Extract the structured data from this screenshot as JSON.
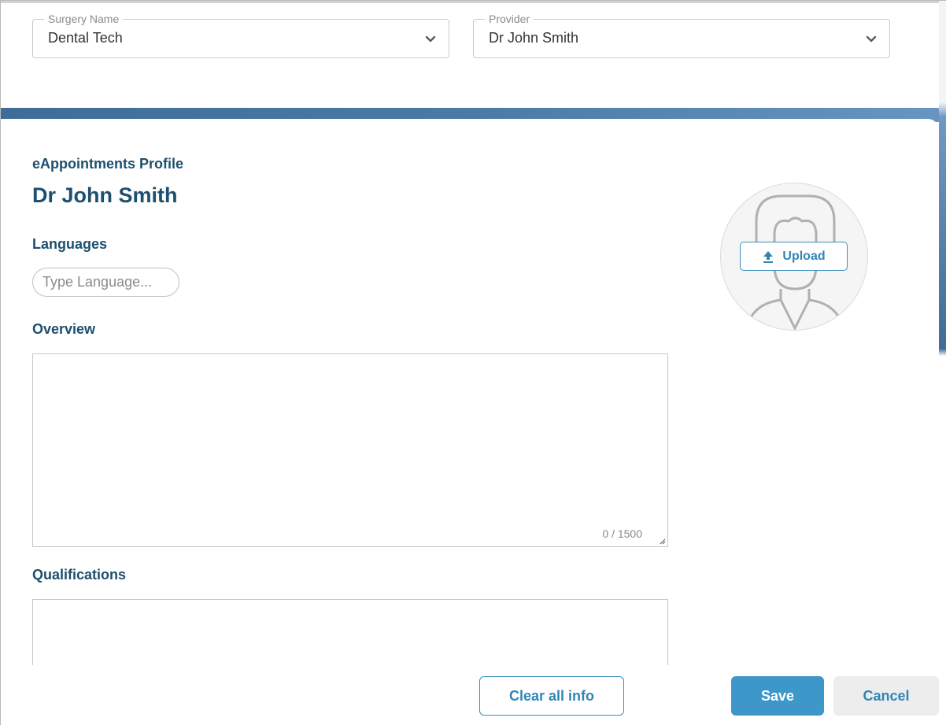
{
  "filters": {
    "surgery": {
      "label": "Surgery Name",
      "value": "Dental Tech"
    },
    "provider": {
      "label": "Provider",
      "value": "Dr John Smith"
    }
  },
  "profile": {
    "section_title": "eAppointments Profile",
    "name": "Dr John Smith",
    "languages_label": "Languages",
    "language_placeholder": "Type Language...",
    "overview_label": "Overview",
    "overview_counter": "0 / 1500",
    "qualifications_label": "Qualifications",
    "upload_label": "Upload"
  },
  "actions": {
    "clear_label": "Clear all info",
    "save_label": "Save",
    "cancel_label": "Cancel"
  },
  "colors": {
    "accent": "#3d97c8",
    "heading": "#1d4f6e",
    "band": "#4a7aa5"
  },
  "icons": {
    "dropdown": "chevron-down-icon",
    "upload": "upload-arrow-icon",
    "avatar": "person-placeholder-icon"
  }
}
